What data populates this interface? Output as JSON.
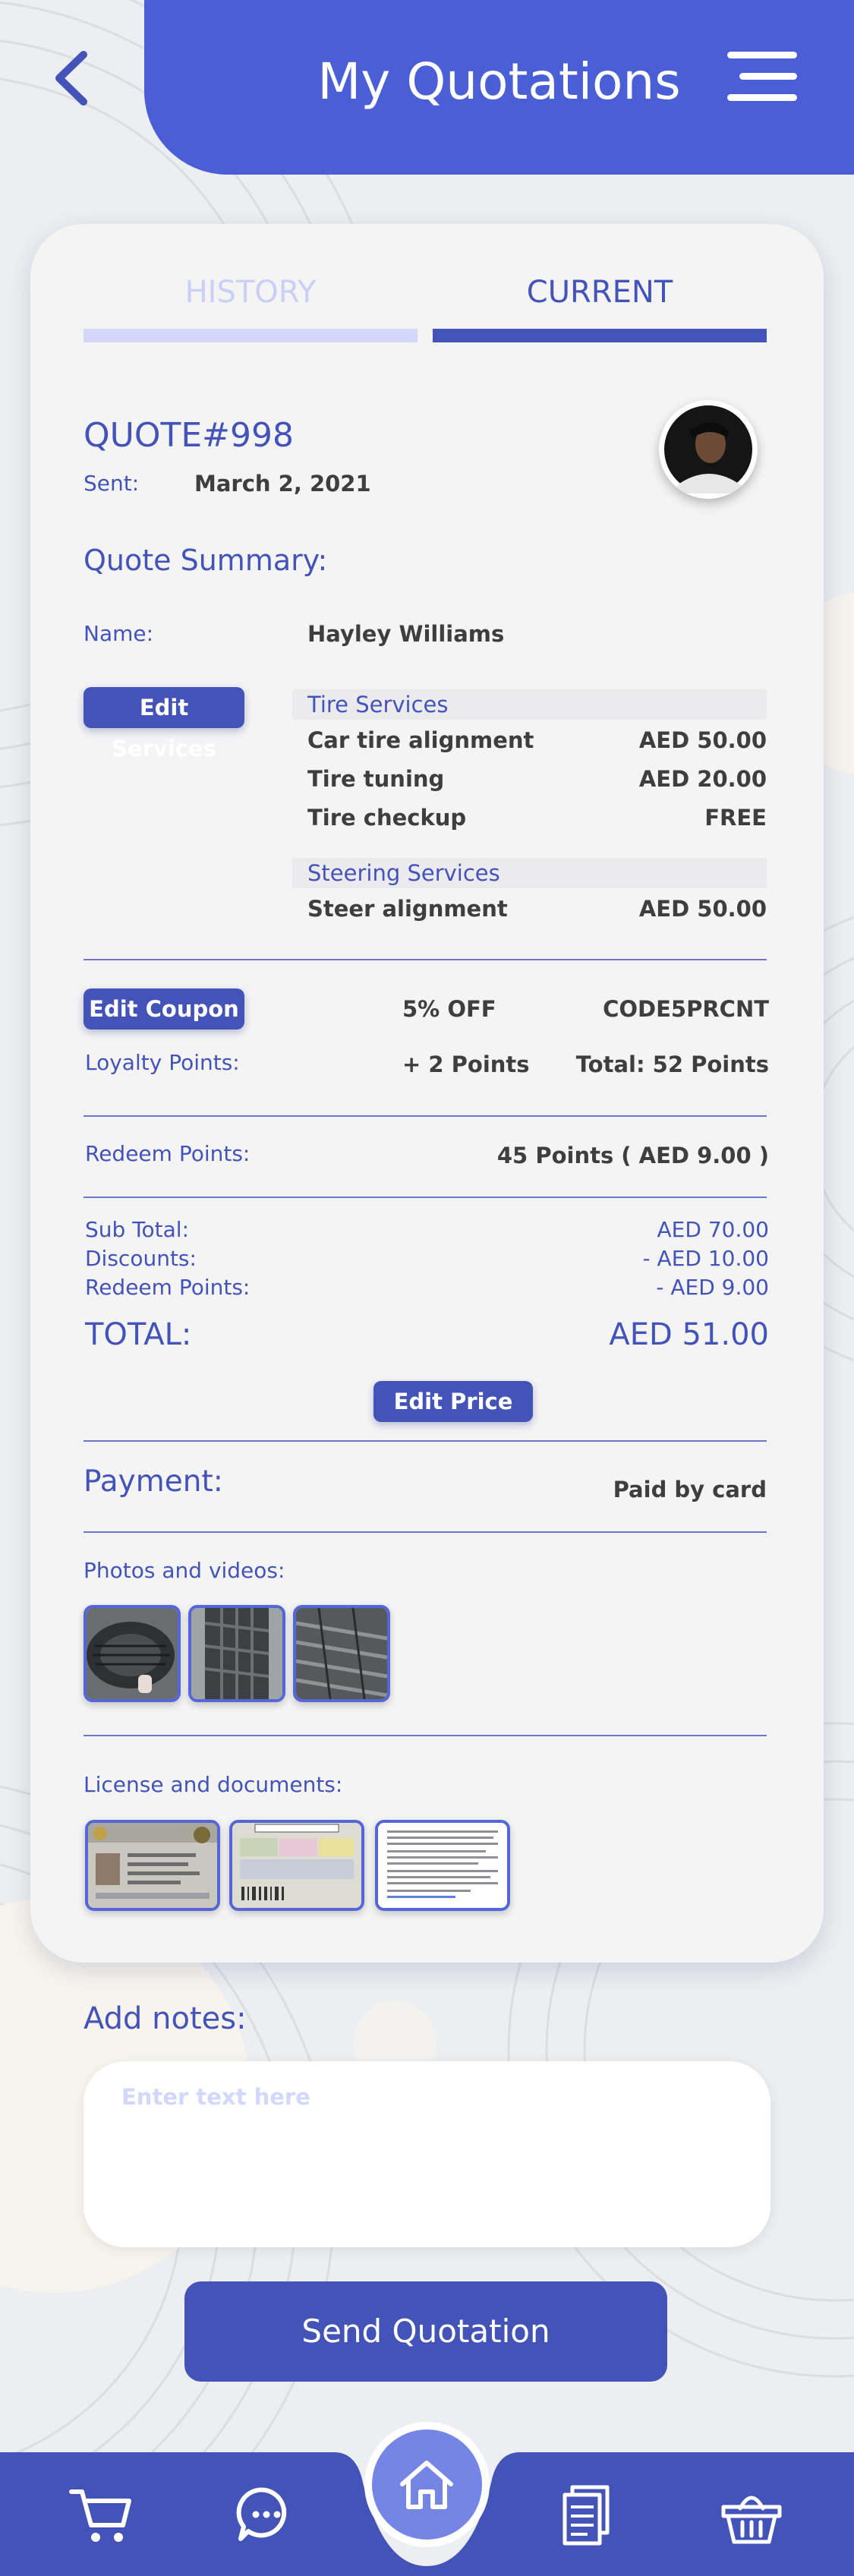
{
  "header": {
    "title": "My Quotations"
  },
  "tabs": [
    {
      "label": "HISTORY",
      "active": false
    },
    {
      "label": "CURRENT",
      "active": true
    }
  ],
  "quote": {
    "number": "QUOTE#998",
    "sent_label": "Sent:",
    "sent_date": "March 2, 2021"
  },
  "summary": {
    "title": "Quote Summary:",
    "name_label": "Name:",
    "name_value": "Hayley Williams",
    "edit_services_label": "Edit Services",
    "groups": [
      {
        "title": "Tire Services",
        "items": [
          {
            "name": "Car tire alignment",
            "price": "AED 50.00"
          },
          {
            "name": "Tire tuning",
            "price": "AED 20.00"
          },
          {
            "name": "Tire checkup",
            "price": "FREE"
          }
        ]
      },
      {
        "title": "Steering Services",
        "items": [
          {
            "name": "Steer alignment",
            "price": "AED 50.00"
          }
        ]
      }
    ]
  },
  "coupon": {
    "edit_label": "Edit Coupon",
    "discount": "5% OFF",
    "code": "CODE5PRCNT"
  },
  "loyalty": {
    "label": "Loyalty Points:",
    "earned": "+ 2 Points",
    "total": "Total:  52 Points"
  },
  "redeem": {
    "label": "Redeem Points:",
    "value": "45 Points ( AED 9.00 )"
  },
  "totals": {
    "rows": [
      {
        "label": "Sub Total:",
        "value": "AED 70.00"
      },
      {
        "label": "Discounts:",
        "value": "- AED 10.00"
      },
      {
        "label": "Redeem Points:",
        "value": "- AED 9.00"
      }
    ],
    "total_label": "TOTAL:",
    "total_value": "AED 51.00",
    "edit_price_label": "Edit Price"
  },
  "payment": {
    "label": "Payment:",
    "value": "Paid by card"
  },
  "photos": {
    "label": "Photos and videos:"
  },
  "documents": {
    "label": "License and documents:"
  },
  "notes": {
    "label": "Add notes:",
    "placeholder": "Enter text here"
  },
  "send_button": "Send Quotation",
  "colors": {
    "primary": "#4453b8",
    "header": "#4a5ed6",
    "nav_home": "#7585e6",
    "muted": "#d3d8fb",
    "text_dark": "#3e3e3e"
  },
  "nav_icons": [
    "cart-icon",
    "chat-icon",
    "home-icon",
    "document-icon",
    "basket-icon"
  ]
}
